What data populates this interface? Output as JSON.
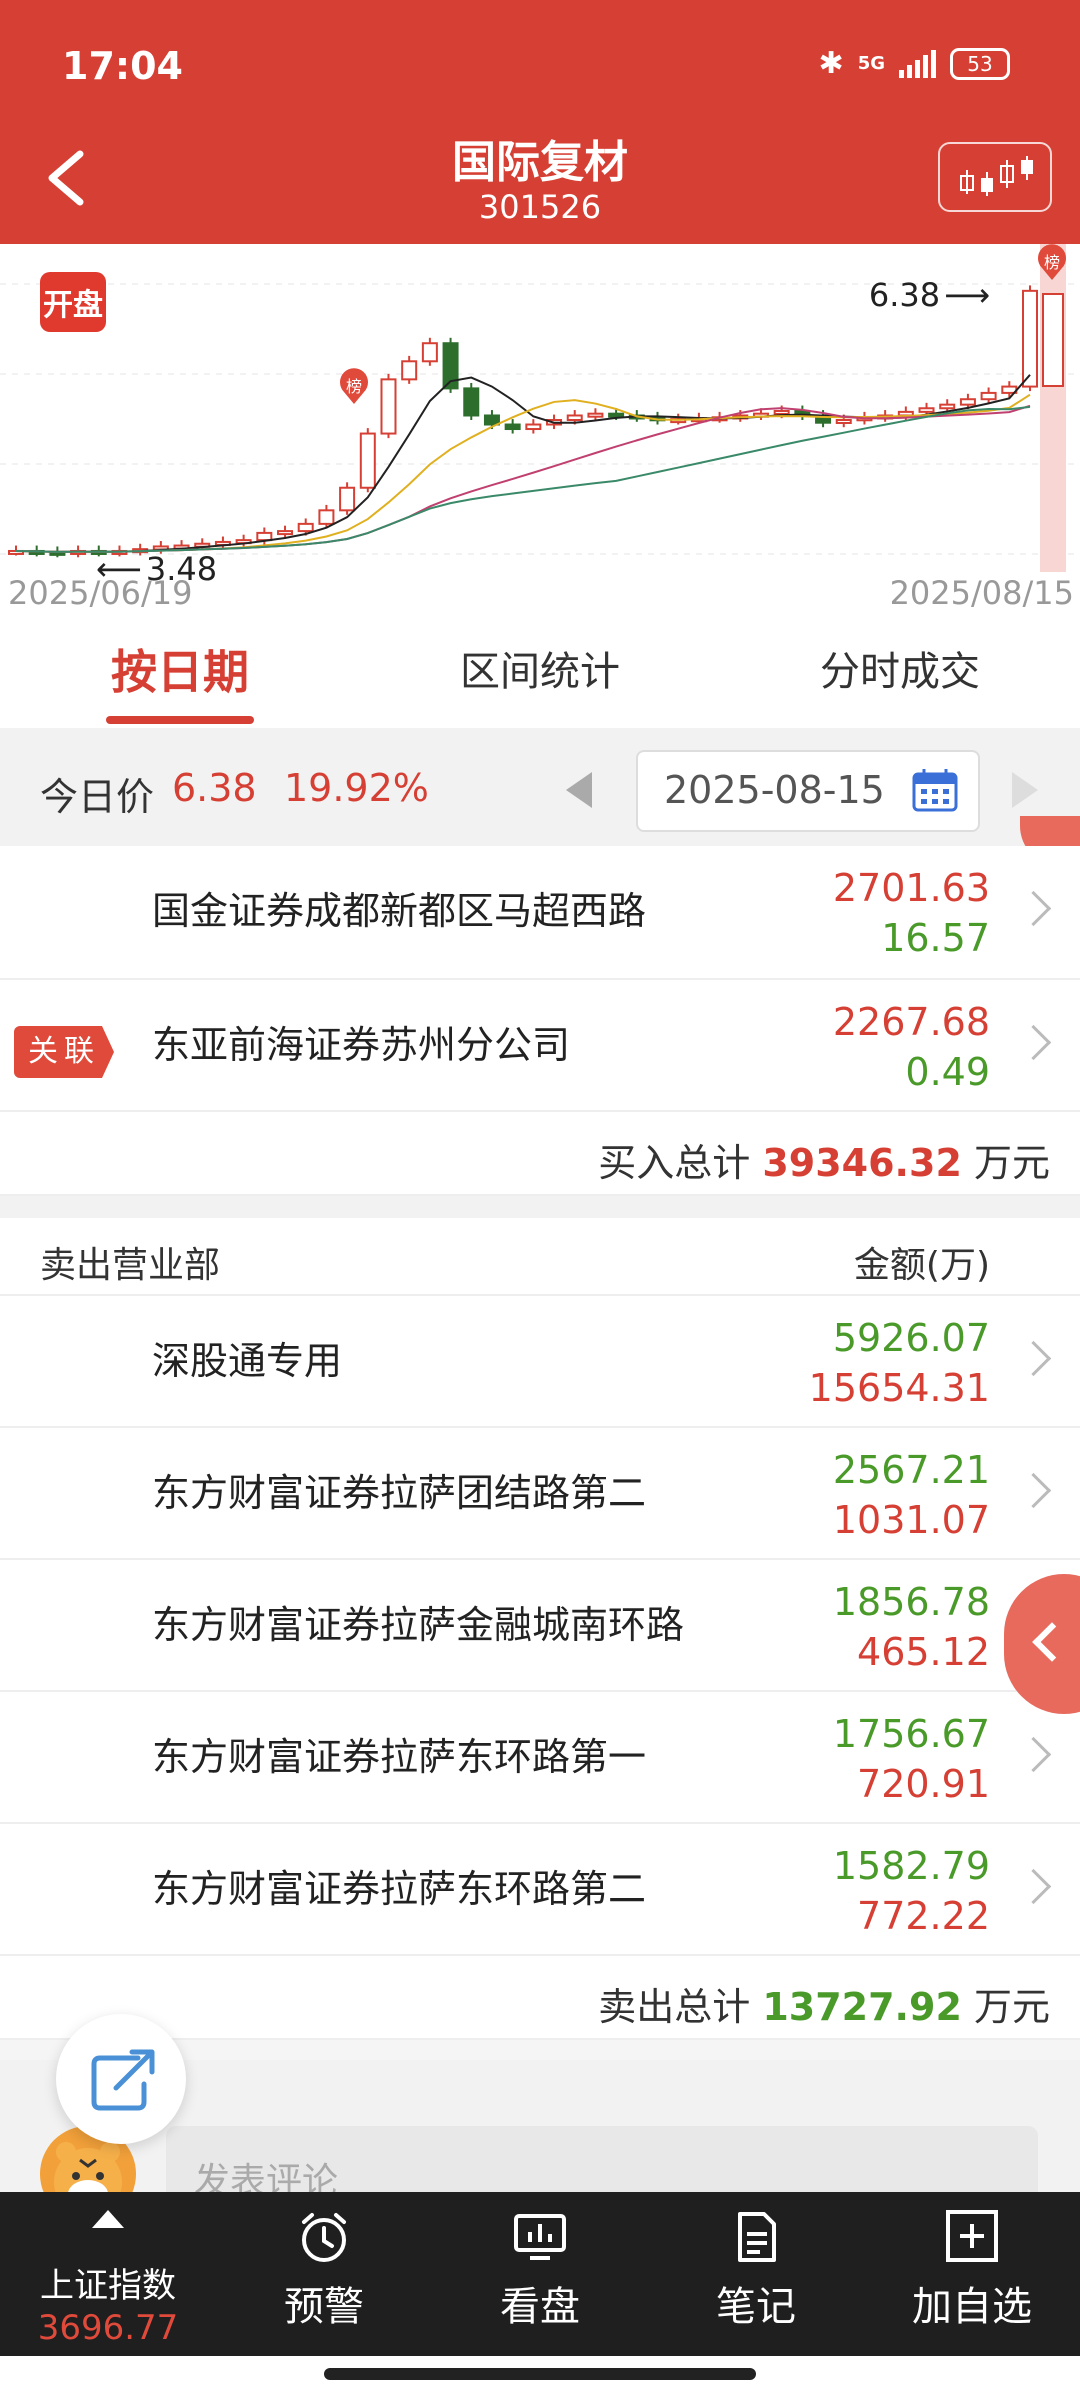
{
  "status": {
    "time": "17:04",
    "network": "5G",
    "battery": "53"
  },
  "header": {
    "title": "国际复材",
    "code": "301526"
  },
  "chart": {
    "badge": "开盘",
    "start_date": "2025/06/19",
    "end_date": "2025/08/15",
    "high_label": "6.38",
    "low_label": "3.48",
    "rank_marker": "榜",
    "colors": {
      "up": "#d63f33",
      "down": "#2d6e2d",
      "ma5": "#222222",
      "ma10": "#e0b020",
      "ma20": "#c04070",
      "ma30": "#3a8a6a"
    }
  },
  "tabs": [
    {
      "label": "按日期",
      "active": true
    },
    {
      "label": "区间统计",
      "active": false
    },
    {
      "label": "分时成交",
      "active": false
    }
  ],
  "pricebar": {
    "label": "今日价",
    "price": "6.38",
    "change": "19.92%",
    "date": "2025-08-15"
  },
  "buy": {
    "rows": [
      {
        "name": "国金证券成都新都区马超西路",
        "v1": "2701.63",
        "v2": "16.57",
        "tag": ""
      },
      {
        "name": "东亚前海证券苏州分公司",
        "v1": "2267.68",
        "v2": "0.49",
        "tag": "关联"
      }
    ],
    "total_label": "买入总计",
    "total_value": "39346.32",
    "total_unit": "万元"
  },
  "sell": {
    "title": "卖出营业部",
    "column": "金额(万)",
    "rows": [
      {
        "name": "深股通专用",
        "v1": "5926.07",
        "v2": "15654.31"
      },
      {
        "name": "东方财富证券拉萨团结路第二",
        "v1": "2567.21",
        "v2": "1031.07"
      },
      {
        "name": "东方财富证券拉萨金融城南环路",
        "v1": "1856.78",
        "v2": "465.12"
      },
      {
        "name": "东方财富证券拉萨东环路第一",
        "v1": "1756.67",
        "v2": "720.91"
      },
      {
        "name": "东方财富证券拉萨东环路第二",
        "v1": "1582.79",
        "v2": "772.22"
      }
    ],
    "total_label": "卖出总计",
    "total_value": "13727.92",
    "total_unit": "万元"
  },
  "comment": {
    "placeholder": "发表评论"
  },
  "nav": {
    "index_name": "上证指数",
    "index_value": "3696.77",
    "items": [
      "预警",
      "看盘",
      "笔记",
      "加自选"
    ]
  }
}
